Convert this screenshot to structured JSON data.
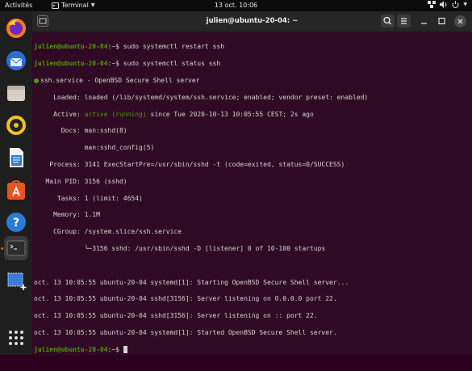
{
  "topbar": {
    "activities": "Activités",
    "app_name": "Terminal",
    "clock": "13 oct.  10:06"
  },
  "dock": {
    "items": [
      "firefox",
      "thunderbird",
      "files",
      "rhythmbox",
      "libreoffice-writer",
      "software",
      "help",
      "terminal",
      "screenshot",
      "show-applications"
    ],
    "colors": {
      "accent": "#e95420",
      "dock_bg": "#1e1e1e"
    }
  },
  "window": {
    "title": "julien@ubuntu-20-04: ~"
  },
  "terminal": {
    "prompt": "julien@ubuntu-20-04",
    "prompt_suffix": ":~$ ",
    "cmd1": "sudo systemctl restart ssh",
    "cmd2": "sudo systemctl status ssh",
    "status_header": "ssh.service - OpenBSD Secure Shell server",
    "loaded": "     Loaded: loaded (/lib/systemd/system/ssh.service; enabled; vendor preset: enabled)",
    "active_label": "     Active: ",
    "active_value": "active (running)",
    "active_rest": " since Tue 2020-10-13 10:05:55 CEST; 2s ago",
    "docs1": "       Docs: man:sshd(8)",
    "docs2": "             man:sshd_config(5)",
    "process": "    Process: 3141 ExecStartPre=/usr/sbin/sshd -t (code=exited, status=0/SUCCESS)",
    "mainpid": "   Main PID: 3156 (sshd)",
    "tasks": "      Tasks: 1 (limit: 4654)",
    "memory": "     Memory: 1.1M",
    "cgroup": "     CGroup: /system.slice/ssh.service",
    "cgroup2": "             └─3156 sshd: /usr/sbin/sshd -D [listener] 0 of 10-100 startups",
    "log": [
      "oct. 13 10:05:55 ubuntu-20-04 systemd[1]: Starting OpenBSD Secure Shell server...",
      "oct. 13 10:05:55 ubuntu-20-04 sshd[3156]: Server listening on 0.0.0.0 port 22.",
      "oct. 13 10:05:55 ubuntu-20-04 sshd[3156]: Server listening on :: port 22.",
      "oct. 13 10:05:55 ubuntu-20-04 systemd[1]: Started OpenBSD Secure Shell server."
    ],
    "colors": {
      "bg": "#300a24",
      "green": "#4e9a06",
      "text": "#d3d7cf"
    }
  }
}
